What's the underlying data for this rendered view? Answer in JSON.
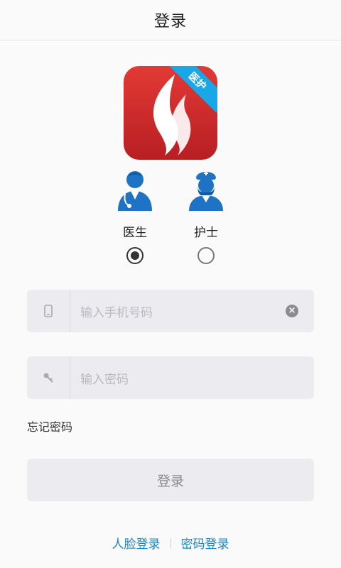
{
  "header": {
    "title": "登录"
  },
  "logo": {
    "ribbon_text": "医护"
  },
  "roles": [
    {
      "label": "医生",
      "selected": true
    },
    {
      "label": "护士",
      "selected": false
    }
  ],
  "phone": {
    "placeholder": "输入手机号码",
    "clear_icon": "clear-icon"
  },
  "password": {
    "placeholder": "输入密码"
  },
  "forgot_label": "忘记密码",
  "login_label": "登录",
  "bottom": {
    "face_login": "人脸登录",
    "password_login": "密码登录"
  },
  "colors": {
    "brand_red": "#d22d2d",
    "ribbon_blue": "#1aa7e8",
    "link_blue": "#1a86c8",
    "role_blue": "#1e73c4"
  }
}
